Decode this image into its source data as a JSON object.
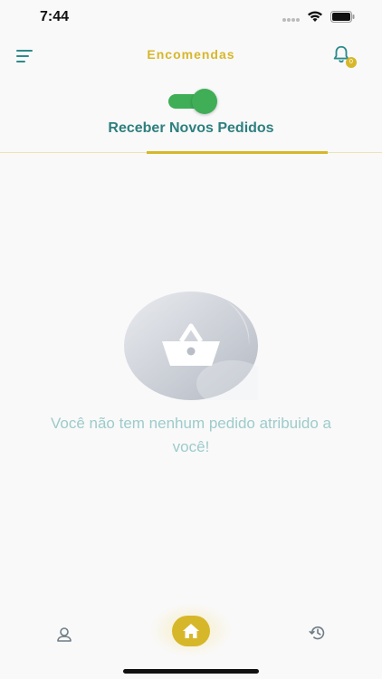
{
  "status_bar": {
    "time": "7:44",
    "icons": [
      "signal-dots-icon",
      "wifi-icon",
      "battery-icon"
    ]
  },
  "header": {
    "title": "Encomendas",
    "menu_icon": "filter-menu-icon",
    "notification_icon": "bell-icon",
    "notification_badge": "0"
  },
  "toggle": {
    "state": "on",
    "color": "#3fae57"
  },
  "tab": {
    "label": "Receber Novos Pedidos"
  },
  "empty_state": {
    "icon": "basket-icon",
    "message": "Você não tem nenhum pedido atribuido a você!"
  },
  "bottom_nav": {
    "items": [
      {
        "icon": "user-icon"
      },
      {
        "icon": "home-icon",
        "active": true
      },
      {
        "icon": "history-icon"
      }
    ]
  },
  "colors": {
    "accent": "#d7b72a",
    "teal": "#2e7f7f",
    "green": "#3fae57",
    "muted_text": "#9ecbcb"
  }
}
